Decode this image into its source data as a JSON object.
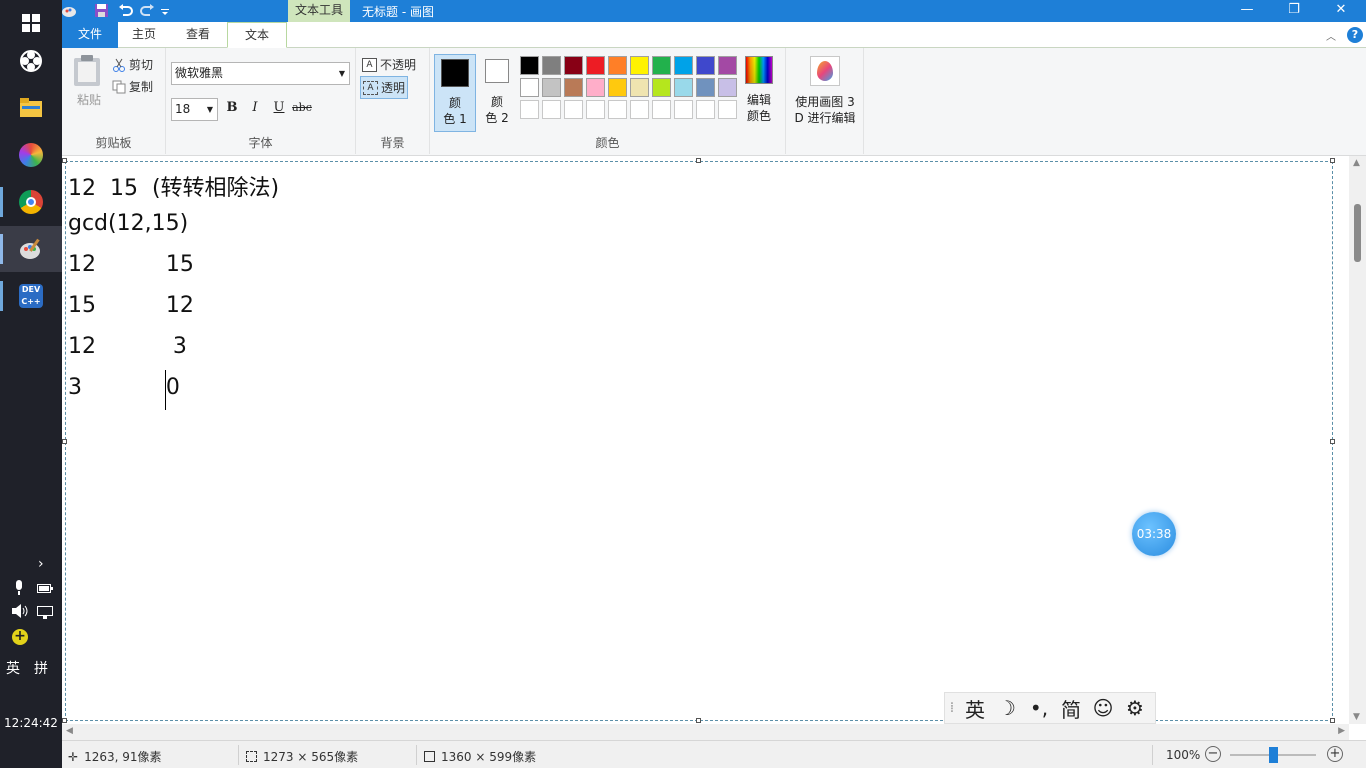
{
  "taskbar": {
    "clock": "12:24:42",
    "ime_lang": "英",
    "ime_grid": "拼",
    "icons": [
      "windows-start-icon",
      "app-fan-icon",
      "file-explorer-icon",
      "colorful-app-icon",
      "chrome-icon",
      "paint-icon",
      "dev-cpp-icon"
    ]
  },
  "titlebar": {
    "context_tab": "文本工具",
    "title": "无标题 - 画图",
    "minimize": "—",
    "restore": "❐",
    "close": "✕"
  },
  "tabs": {
    "file": "文件",
    "home": "主页",
    "view": "查看",
    "text": "文本"
  },
  "ribbon": {
    "clipboard": {
      "label": "剪贴板",
      "paste": "粘贴",
      "cut": "剪切",
      "copy": "复制"
    },
    "font": {
      "label": "字体",
      "family": "微软雅黑",
      "size": "18",
      "bold": "B",
      "italic": "I",
      "underline": "U",
      "strikethrough": "abc"
    },
    "background": {
      "label": "背景",
      "opaque": "不透明",
      "transparent": "透明"
    },
    "colors": {
      "label": "颜色",
      "color1": "颜\n色 1",
      "color2": "颜\n色 2",
      "edit_colors": "编辑\n颜色",
      "paint3d": "使用画图 3\nD 进行编辑",
      "color1_value": "#000000",
      "color2_value": "#ffffff",
      "palette_row1": [
        "#000000",
        "#7f7f7f",
        "#880015",
        "#ed1c24",
        "#ff7f27",
        "#fff200",
        "#22b14c",
        "#00a2e8",
        "#3f48cc",
        "#a349a4"
      ],
      "palette_row2": [
        "#ffffff",
        "#c3c3c3",
        "#b97a57",
        "#ffaec9",
        "#ffc90e",
        "#efe4b0",
        "#b5e61d",
        "#99d9ea",
        "#7092be",
        "#c8bfe7"
      ],
      "palette_row3": [
        "#ffffff",
        "#ffffff",
        "#ffffff",
        "#ffffff",
        "#ffffff",
        "#ffffff",
        "#ffffff",
        "#ffffff",
        "#ffffff",
        "#ffffff"
      ]
    }
  },
  "canvas": {
    "lines": [
      "12  15  (转转相除法)",
      "gcd(12,15)",
      "12          15",
      "15          12",
      "12           3",
      "3            0"
    ]
  },
  "timer": "03:38",
  "ime_bar": {
    "lang": "英",
    "moon": "☽",
    "punct": "•,",
    "simplified": "简",
    "emoji": "☺",
    "settings": "⚙"
  },
  "statusbar": {
    "cursor_pos": "1263, 91像素",
    "selection_size": "1273 × 565像素",
    "image_size": "1360 × 599像素",
    "zoom": "100%"
  }
}
